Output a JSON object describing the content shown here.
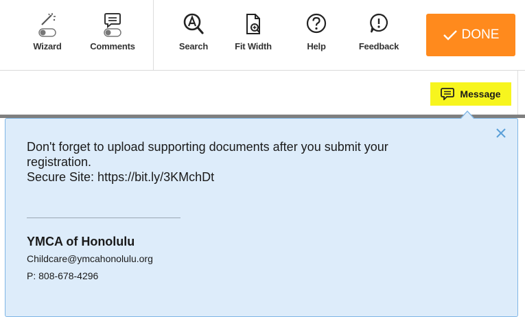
{
  "toolbar": {
    "tools": [
      {
        "label": "Wizard",
        "icon": "wand-toggle-icon"
      },
      {
        "label": "Comments",
        "icon": "comment-toggle-icon"
      },
      {
        "label": "Search",
        "icon": "search-icon"
      },
      {
        "label": "Fit Width",
        "icon": "fit-width-icon"
      },
      {
        "label": "Help",
        "icon": "help-icon"
      },
      {
        "label": "Feedback",
        "icon": "feedback-icon"
      }
    ],
    "done_label": "DONE"
  },
  "message_button": {
    "label": "Message",
    "icon": "message-icon"
  },
  "popup": {
    "lines": [
      "Don't forget to upload supporting documents after you submit your",
      "registration.",
      "Secure Site: https://bit.ly/3KMchDt"
    ],
    "org_name": "YMCA of Honolulu",
    "email": "Childcare@ymcahonolulu.org",
    "phone": "P: 808-678-4296"
  },
  "colors": {
    "done_bg": "#ff8a1d",
    "highlight": "#f7f51e",
    "popup_bg": "#ddecfa",
    "popup_border": "#7fb6e6",
    "close_icon": "#5a9fd8"
  }
}
